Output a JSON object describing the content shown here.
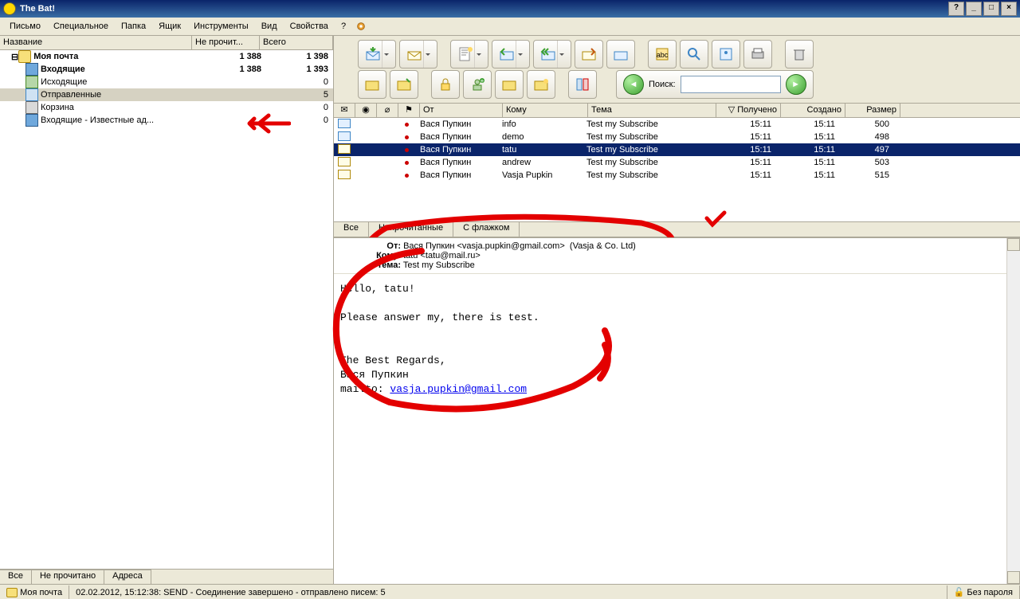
{
  "window": {
    "title": "The Bat!"
  },
  "menu": {
    "items": [
      "Письмо",
      "Специальное",
      "Папка",
      "Ящик",
      "Инструменты",
      "Вид",
      "Свойства",
      "?"
    ]
  },
  "tree": {
    "headers": {
      "name": "Название",
      "unread": "Не прочит...",
      "total": "Всего"
    },
    "root": {
      "label": "Моя почта",
      "unread": "1 388",
      "total": "1 398"
    },
    "folders": [
      {
        "label": "Входящие",
        "unread": "1 388",
        "total": "1 393",
        "bold": true,
        "icon": "inbox"
      },
      {
        "label": "Исходящие",
        "unread": "",
        "total": "0",
        "icon": "outbox"
      },
      {
        "label": "Отправленные",
        "unread": "",
        "total": "5",
        "icon": "sent",
        "selected": true
      },
      {
        "label": "Корзина",
        "unread": "",
        "total": "0",
        "icon": "trash"
      },
      {
        "label": "Входящие - Известные ад...",
        "unread": "",
        "total": "0",
        "icon": "inbox"
      }
    ]
  },
  "left_tabs": [
    "Все",
    "Не прочитано",
    "Адреса"
  ],
  "search": {
    "label": "Поиск:"
  },
  "messages": {
    "headers": {
      "from": "От",
      "to": "Кому",
      "subject": "Тема",
      "received": "Получено",
      "created": "Создано",
      "size": "Размер"
    },
    "rows": [
      {
        "from": "Вася Пупкин",
        "to": "info",
        "subject": "Test my Subscribe",
        "received": "15:11",
        "created": "15:11",
        "size": "500"
      },
      {
        "from": "Вася Пупкин",
        "to": "demo",
        "subject": "Test my Subscribe",
        "received": "15:11",
        "created": "15:11",
        "size": "498"
      },
      {
        "from": "Вася Пупкин",
        "to": "tatu",
        "subject": "Test my Subscribe",
        "received": "15:11",
        "created": "15:11",
        "size": "497",
        "selected": true
      },
      {
        "from": "Вася Пупкин",
        "to": "andrew",
        "subject": "Test my Subscribe",
        "received": "15:11",
        "created": "15:11",
        "size": "503"
      },
      {
        "from": "Вася Пупкин",
        "to": "Vasja Pupkin",
        "subject": "Test my Subscribe",
        "received": "15:11",
        "created": "15:11",
        "size": "515"
      }
    ]
  },
  "filter_tabs": [
    "Все",
    "Непрочитанные",
    "С флажком"
  ],
  "preview": {
    "labels": {
      "from": "От:",
      "to": "Кому:",
      "subject": "Тема:"
    },
    "from": "Вася Пупкин <vasja.pupkin@gmail.com>",
    "org": "(Vasja & Co. Ltd)",
    "to": "tatu <tatu@mail.ru>",
    "subject": "Test my Subscribe",
    "body_l1": "Hello, tatu!",
    "body_l2": "Please answer my, there is test.",
    "sig1": "The Best Regards,",
    "sig2": "Вася Пупкин",
    "mailto_prefix": "mailto:",
    "mailto_link": "vasja.pupkin@gmail.com"
  },
  "status": {
    "account": "Моя почта",
    "log": "02.02.2012, 15:12:38: SEND  - Соединение завершено - отправлено писем: 5",
    "lock": "Без пароля"
  }
}
